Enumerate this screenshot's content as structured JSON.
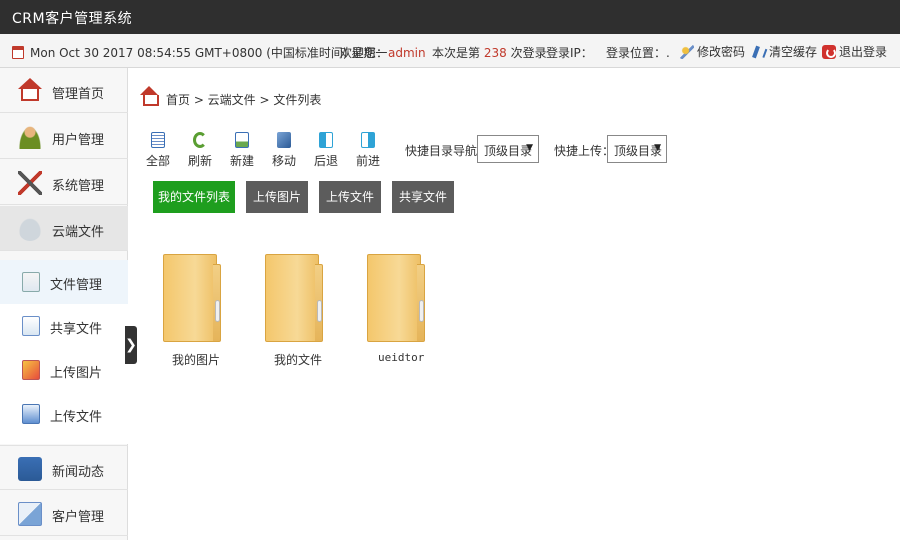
{
  "app": {
    "title": "CRM客户管理系统"
  },
  "infobar": {
    "datetime": "Mon Oct 30 2017 08:54:55 GMT+0800 (中国标准时间) 星期一",
    "welcome_prefix": "欢迎您：",
    "username": "admin",
    "login_count_prefix": "本次是第",
    "login_count": "238",
    "login_count_suffix": "次登录",
    "login_ip_label": "登录IP：",
    "login_location_label": "登录位置：.",
    "change_password": "修改密码",
    "clear_cache": "清空缓存",
    "logout": "退出登录"
  },
  "sidebar": {
    "items": [
      {
        "label": "管理首页",
        "icon": "home-icon"
      },
      {
        "label": "用户管理",
        "icon": "user-icon"
      },
      {
        "label": "系统管理",
        "icon": "tools-icon"
      },
      {
        "label": "云端文件",
        "icon": "cloud-icon"
      }
    ],
    "subitems": [
      {
        "label": "文件管理",
        "icon": "file-manager-icon"
      },
      {
        "label": "共享文件",
        "icon": "share-file-icon"
      },
      {
        "label": "上传图片",
        "icon": "image-icon"
      },
      {
        "label": "上传文件",
        "icon": "upload-file-icon"
      }
    ],
    "items_bottom": [
      {
        "label": "新闻动态",
        "icon": "news-icon"
      },
      {
        "label": "客户管理",
        "icon": "customer-icon"
      }
    ],
    "collapse_glyph": "❯"
  },
  "breadcrumb": {
    "text": "首页 > 云端文件 > 文件列表"
  },
  "toolbar": {
    "buttons": [
      {
        "label": "全部",
        "icon": "list-all-icon"
      },
      {
        "label": "刷新",
        "icon": "refresh-icon"
      },
      {
        "label": "新建",
        "icon": "new-icon"
      },
      {
        "label": "移动",
        "icon": "move-icon"
      },
      {
        "label": "后退",
        "icon": "back-icon"
      },
      {
        "label": "前进",
        "icon": "forward-icon"
      }
    ],
    "dir_nav_label": "快捷目录导航：",
    "dir_nav_value": "顶级目录",
    "upload_label": "快捷上传：",
    "upload_value": "顶级目录",
    "caret": "▼"
  },
  "tabs": [
    {
      "label": "我的文件列表",
      "active": true
    },
    {
      "label": "上传图片",
      "active": false
    },
    {
      "label": "上传文件",
      "active": false
    },
    {
      "label": "共享文件",
      "active": false
    }
  ],
  "folders": [
    {
      "name": "我的图片"
    },
    {
      "name": "我的文件"
    },
    {
      "name": "ueidtor"
    }
  ],
  "colors": {
    "accent_green": "#1e9e1e",
    "tab_gray": "#5c5c5c",
    "title_bar": "#2f2f2f",
    "alert_red": "#c0392b"
  }
}
